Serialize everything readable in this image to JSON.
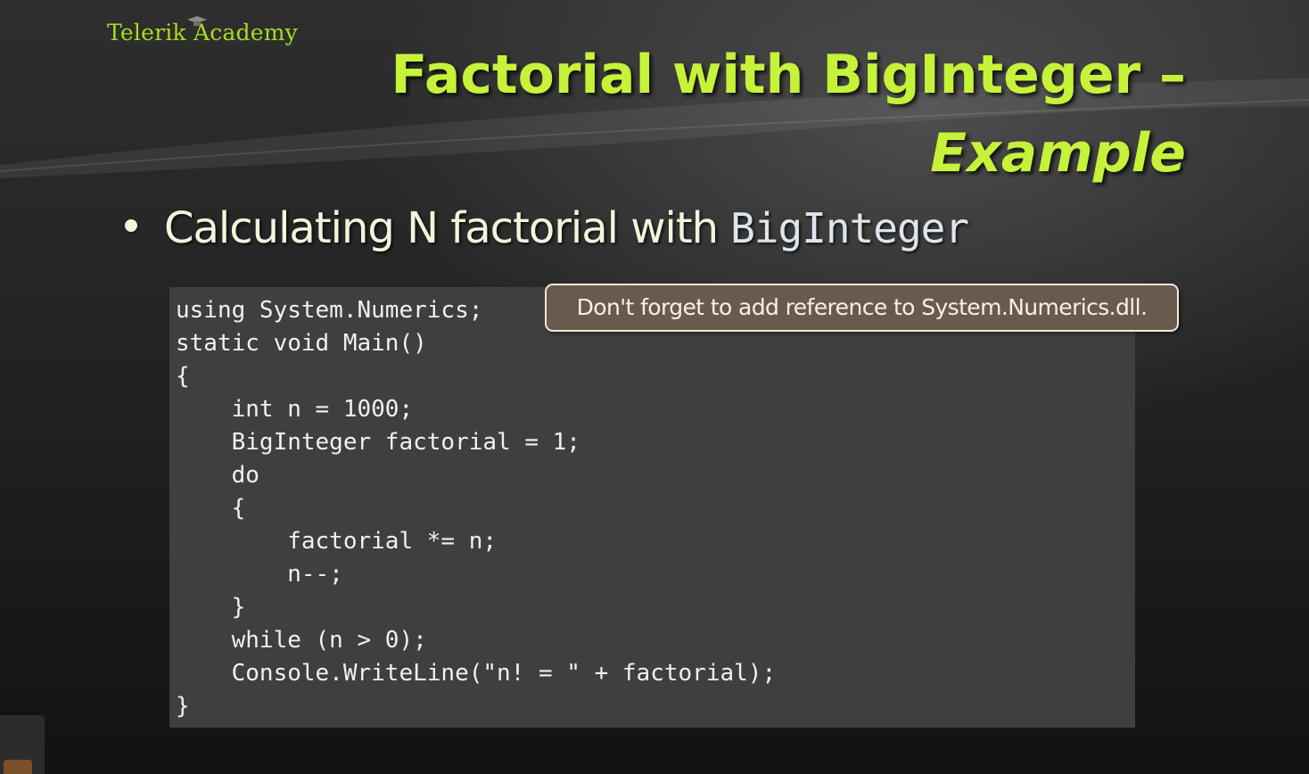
{
  "slide": {
    "logo": "Telerik Academy",
    "title_line1": "Factorial with BigInteger –",
    "title_line2": "Example",
    "bullet": {
      "text": "Calculating N factorial with",
      "code": "BigInteger"
    },
    "callout": "Don't forget to add reference to System.Numerics.dll.",
    "code_lines": [
      "using System.Numerics;",
      "static void Main()",
      "{",
      "    int n = 1000;",
      "    BigInteger factorial = 1;",
      "    do",
      "    {",
      "        factorial *= n;",
      "        n--;",
      "    }",
      "    while (n > 0);",
      "    Console.WriteLine(\"n! = \" + factorial);",
      "}"
    ]
  },
  "colors": {
    "title": "#c6f23a",
    "logo": "#a8dc1e",
    "code_background": "#3f3f3f",
    "callout_background": "#6a5a4e"
  },
  "icons": {
    "logo_decoration": "graduation-cap-icon",
    "corner": "rss-icon"
  }
}
